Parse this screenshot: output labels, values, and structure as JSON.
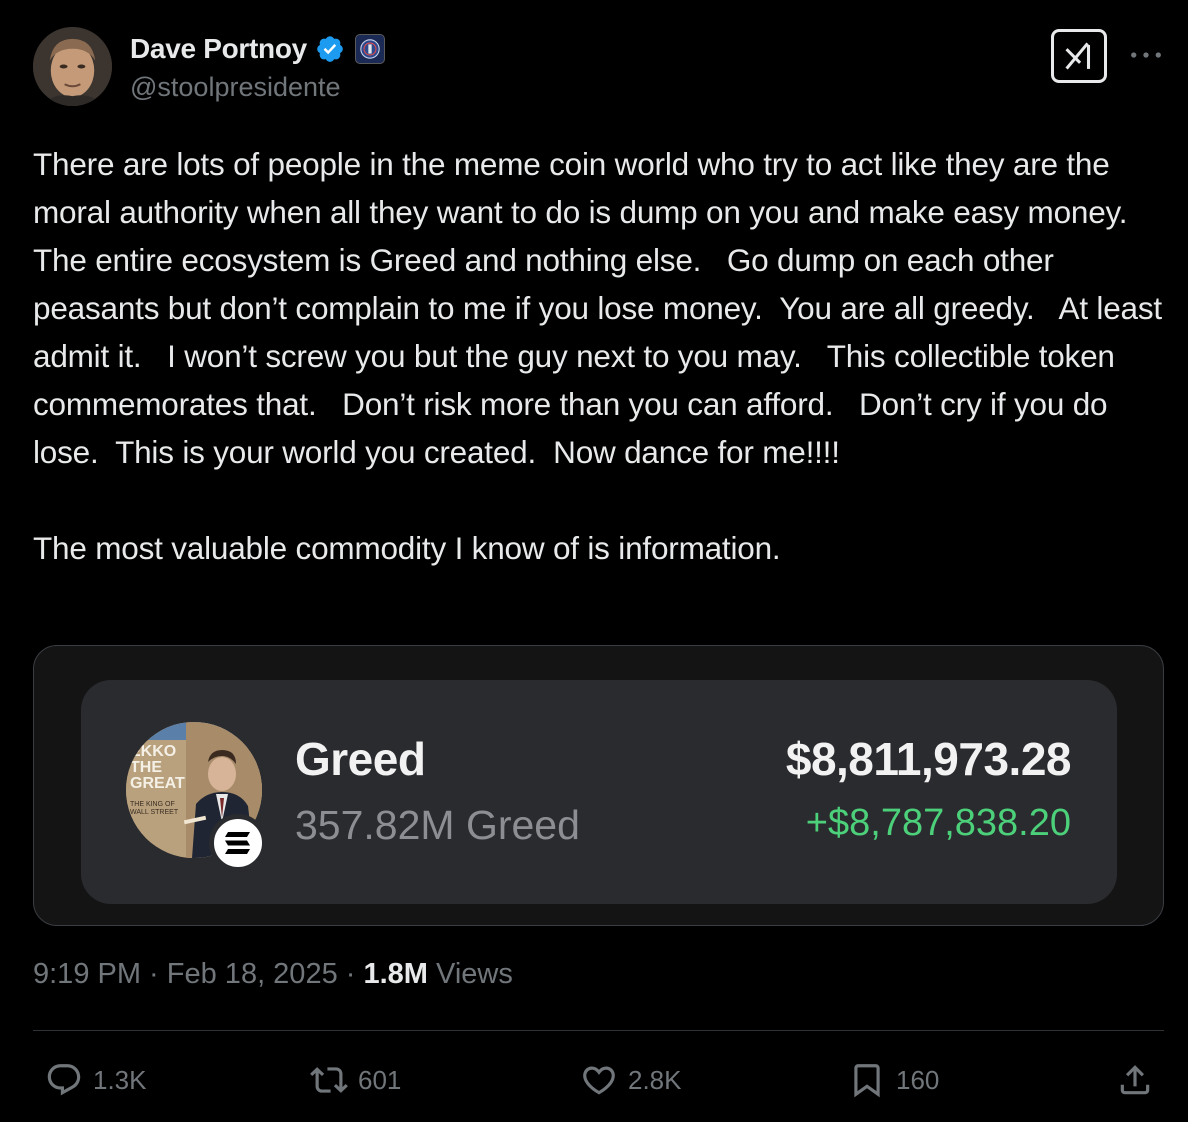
{
  "author": {
    "display_name": "Dave Portnoy",
    "handle": "@stoolpresidente"
  },
  "icons": {
    "verified": "verified-badge-icon",
    "affiliation": "barstool-affiliate-badge",
    "grok": "grok-icon",
    "more": "more-options-icon",
    "solana": "solana-logo-icon",
    "reply": "reply-icon",
    "repost": "repost-icon",
    "like": "like-icon",
    "bookmark": "bookmark-icon",
    "share": "share-icon"
  },
  "tweet": {
    "paragraphs": [
      "There are lots of people in the meme coin world who try to act like they are the moral authority when all they want to do is dump on you and make easy money.  The entire ecosystem is Greed and nothing else.   Go dump on each other peasants but don’t complain to me if you lose money.  You are all greedy.   At least admit it.   I won’t screw you but the guy next to you may.   This collectible token commemorates that.   Don’t risk more than you can afford.   Don’t cry if you do lose.  This is your world you created.  Now dance for me!!!!",
      "The most valuable commodity I know of is information."
    ]
  },
  "token_card": {
    "name": "Greed",
    "amount": "357.82M Greed",
    "value": "$8,811,973.28",
    "change": "+$8,787,838.20",
    "image_text": {
      "line1": "EKKO",
      "line2": "THE",
      "line3": "GREAT",
      "line4": "THE KING OF",
      "line5": "WALL STREET"
    }
  },
  "meta": {
    "time": "9:19 PM",
    "separator": " · ",
    "date": "Feb 18, 2025",
    "views_count": "1.8M",
    "views_label": " Views"
  },
  "actions": {
    "replies": "1.3K",
    "reposts": "601",
    "likes": "2.8K",
    "bookmarks": "160"
  },
  "colors": {
    "background": "#000000",
    "text_primary": "#e7e9ea",
    "text_secondary": "#71767b",
    "verified_blue": "#1d9bf0",
    "gain_green": "#4cd07a",
    "card_bg": "#2a2b2f"
  }
}
